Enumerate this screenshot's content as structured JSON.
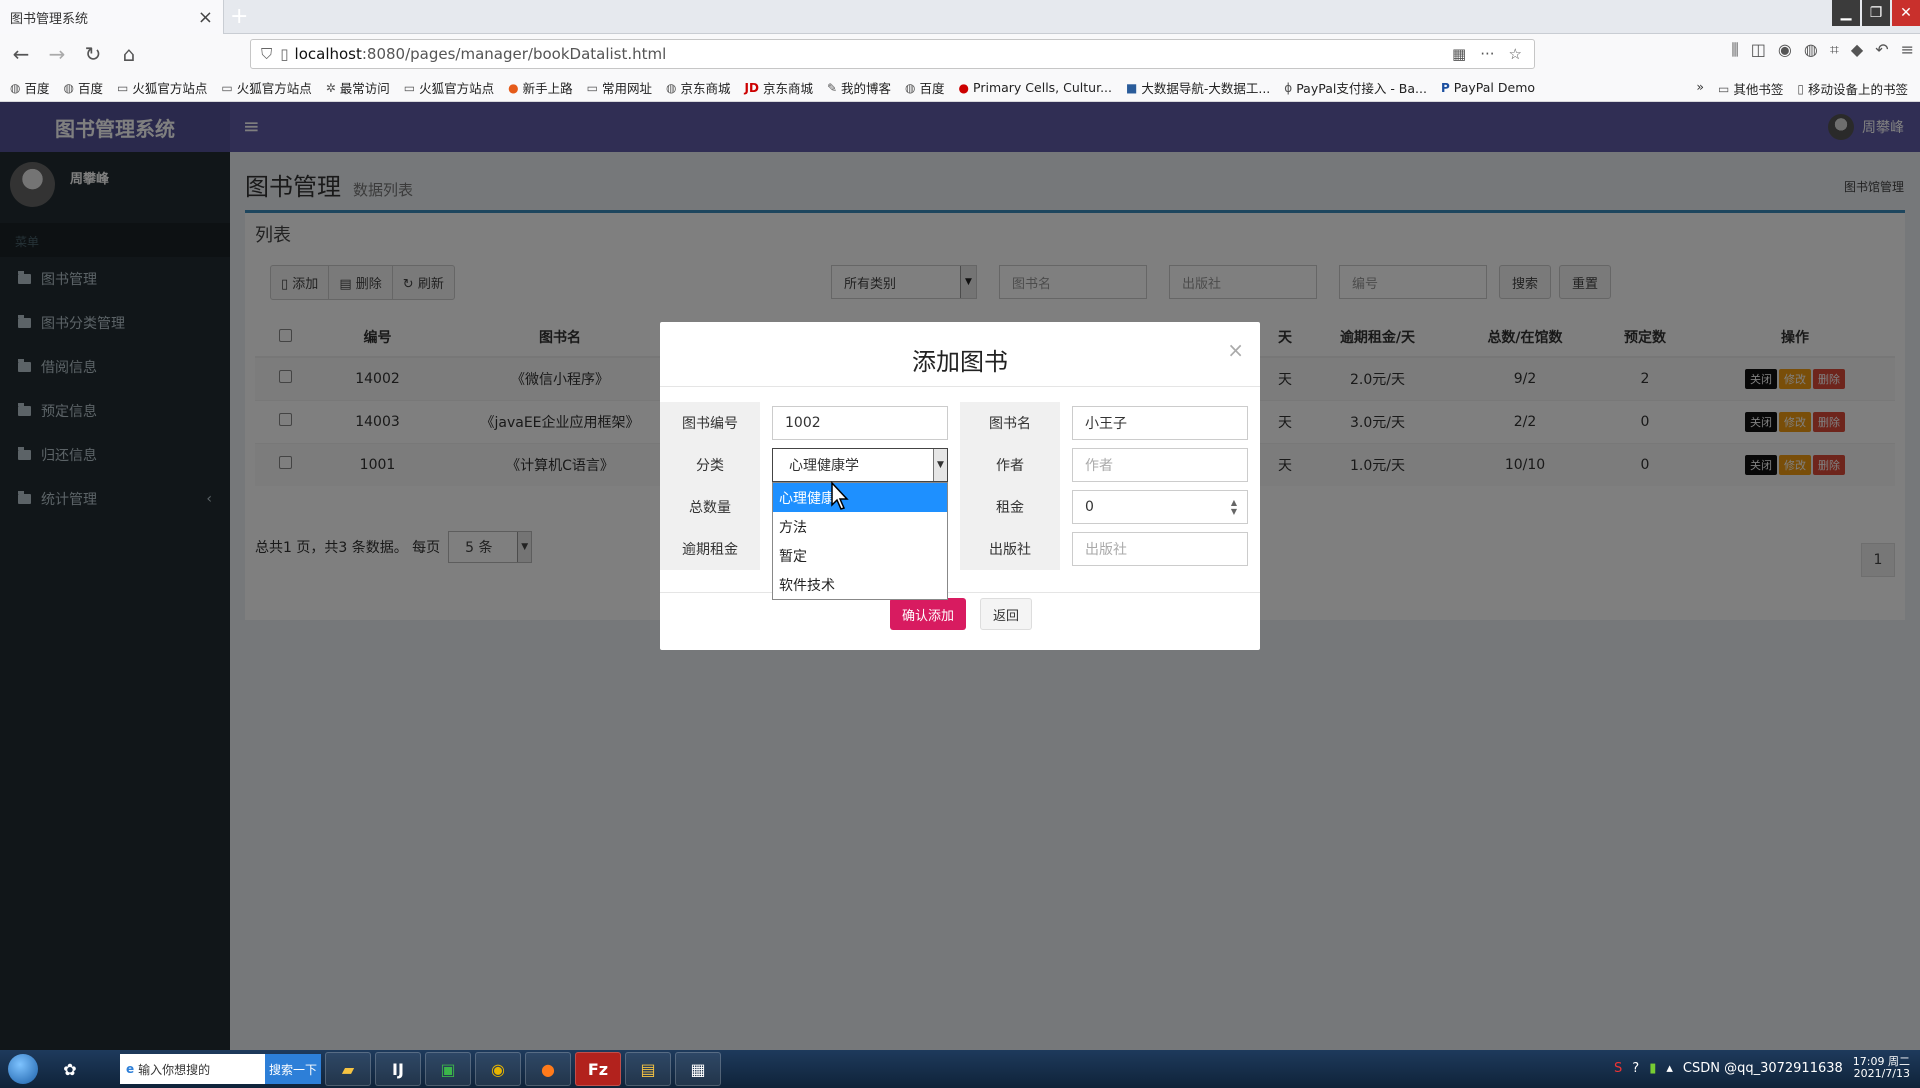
{
  "browser": {
    "tab_title": "图书管理系统",
    "url_host": "localhost",
    "url_path": ":8080/pages/manager/bookDatalist.html",
    "bookmarks": [
      "百度",
      "百度",
      "火狐官方站点",
      "火狐官方站点",
      "最常访问",
      "火狐官方站点",
      "新手上路",
      "常用网址",
      "京东商城",
      "京东商城",
      "我的博客",
      "百度",
      "Primary Cells, Cultur...",
      "大数据导航-大数据工...",
      "PayPal支付接入 - Ba...",
      "PayPal Demo"
    ],
    "bookmarks_right": [
      "其他书签",
      "移动设备上的书签"
    ]
  },
  "app": {
    "logo": "图书管理系统",
    "user_name": "周攀峰"
  },
  "sidebar": {
    "user_name": "周攀峰",
    "menu_header": "菜单",
    "items": [
      {
        "label": "图书管理"
      },
      {
        "label": "图书分类管理"
      },
      {
        "label": "借阅信息"
      },
      {
        "label": "预定信息"
      },
      {
        "label": "归还信息"
      },
      {
        "label": "统计管理"
      }
    ]
  },
  "page": {
    "title": "图书管理",
    "subtitle": "数据列表",
    "breadcrumb": "图书馆管理",
    "box_title": "列表",
    "toolbar": {
      "add": "添加",
      "delete": "删除",
      "refresh": "刷新"
    },
    "filters": {
      "category": "所有类别",
      "book_name_ph": "图书名",
      "publisher_ph": "出版社",
      "number_ph": "编号",
      "search": "搜索",
      "reset": "重置"
    },
    "table": {
      "headers": [
        "编号",
        "图书名",
        "天",
        "逾期租金/天",
        "总数/在馆数",
        "预定数",
        "操作"
      ],
      "rows": [
        {
          "id": "14002",
          "name": "《微信小程序》",
          "rent": "天",
          "overdue": "2.0元/天",
          "stock": "9/2",
          "reserved": "2"
        },
        {
          "id": "14003",
          "name": "《javaEE企业应用框架》",
          "rent": "天",
          "overdue": "3.0元/天",
          "stock": "2/2",
          "reserved": "0"
        },
        {
          "id": "1001",
          "name": "《计算机C语言》",
          "rent": "天",
          "overdue": "1.0元/天",
          "stock": "10/10",
          "reserved": "0"
        }
      ],
      "actions": {
        "close": "关闭",
        "edit": "修改",
        "delete": "删除"
      }
    },
    "pager": {
      "summary": "总共1 页，共3 条数据。 每页",
      "per_page": "5 条",
      "page": "1"
    }
  },
  "modal": {
    "title": "添加图书",
    "close": "×",
    "labels": {
      "book_no": "图书编号",
      "book_name": "图书名",
      "category": "分类",
      "author": "作者",
      "total": "总数量",
      "rent": "租金",
      "overdue": "逾期租金",
      "publisher": "出版社"
    },
    "values": {
      "book_no": "1002",
      "book_name": "小王子",
      "category": "心理健康学",
      "rent": "0"
    },
    "placeholders": {
      "author": "作者",
      "publisher": "出版社"
    },
    "dropdown_options": [
      "心理健康",
      "方法",
      "暂定",
      "软件技术"
    ],
    "confirm": "确认添加",
    "back": "返回"
  },
  "taskbar": {
    "search_text": "输入你想搜的",
    "search_button": "搜索一下",
    "watermark": "CSDN @qq_3072911638",
    "time": "17:09 周二",
    "date": "2021/7/13"
  }
}
